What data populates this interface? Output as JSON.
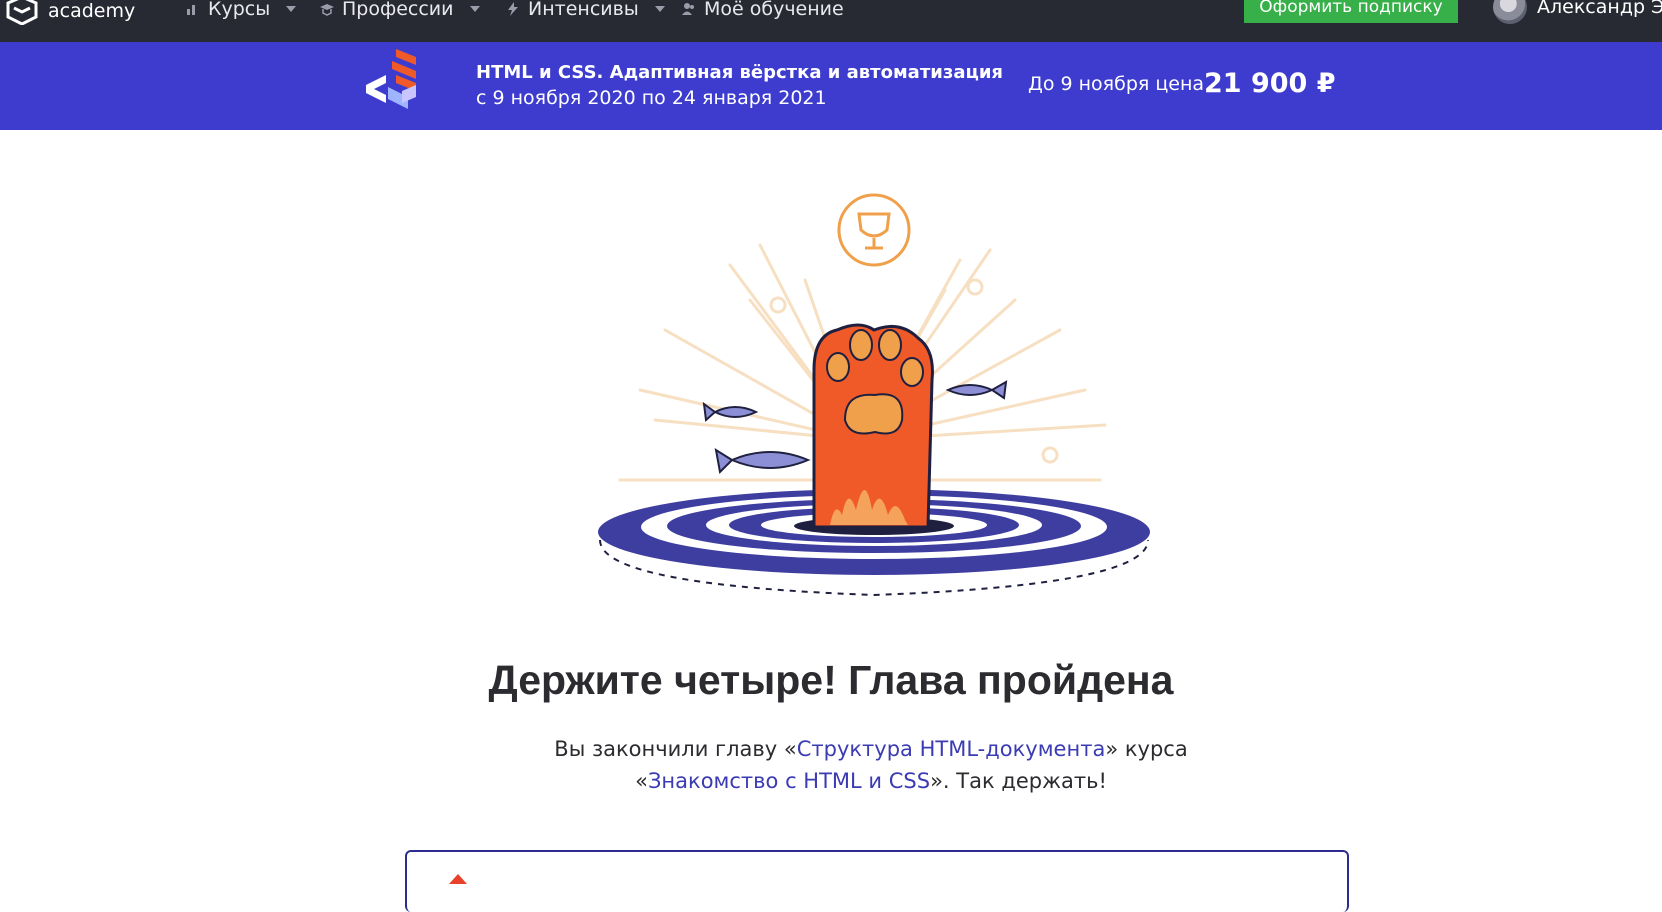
{
  "nav": {
    "logo_text": "academy",
    "items": [
      {
        "label": "Курсы"
      },
      {
        "label": "Профессии"
      },
      {
        "label": "Интенсивы"
      },
      {
        "label": "Моё обучение"
      }
    ],
    "subscribe_label": "Оформить подписку",
    "user_name": "Александр Э"
  },
  "promo": {
    "title": "HTML и CSS. Адаптивная вёрстка и автоматизация",
    "dates": "с 9 ноября 2020 по 24 января 2021",
    "price_label": "До 9 ноября цена",
    "price": "21 900 ₽"
  },
  "main": {
    "headline": "Держите четыре! Глава пройдена",
    "desc_prefix": "Вы закончили главу «",
    "chapter_link": "Структура HTML-документа",
    "desc_middle": "» курса «",
    "course_link": "Знакомство с HTML и CSS",
    "desc_suffix": "». Так держать!"
  },
  "colors": {
    "nav_bg": "#272a33",
    "promo_bg": "#3d3ccf",
    "subscribe_bg": "#37b04a",
    "link": "#3b3bb3",
    "paw": "#f05a28",
    "trophy": "#f0a04b"
  }
}
